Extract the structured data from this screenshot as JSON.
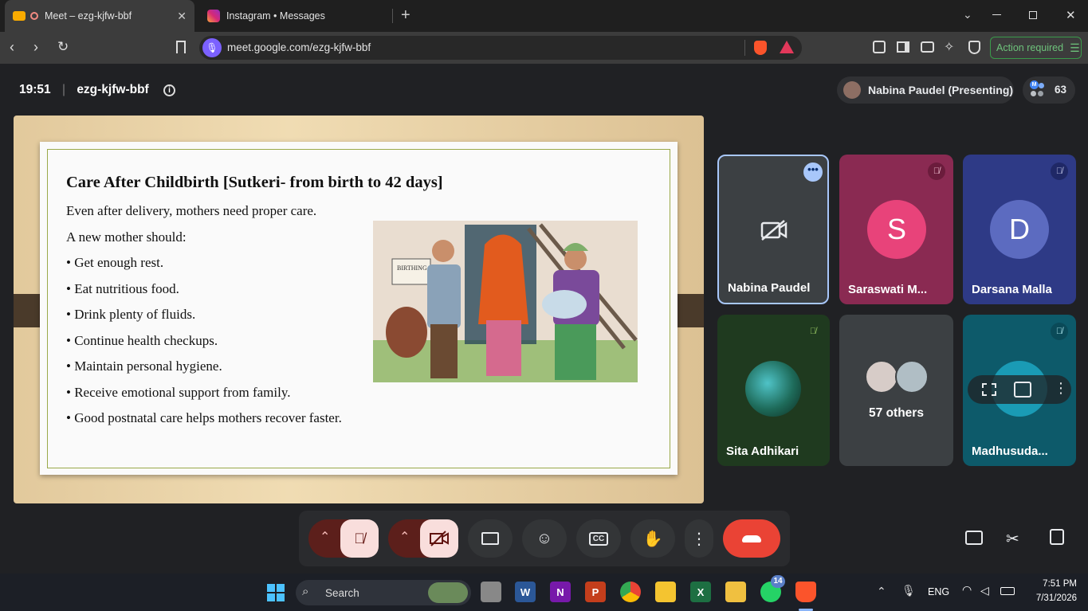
{
  "browser": {
    "tabs": [
      {
        "title": "Meet – ezg-kjfw-bbf",
        "active": true
      },
      {
        "title": "Instagram • Messages",
        "active": false
      }
    ],
    "url": "meet.google.com/ezg-kjfw-bbf",
    "action_required": "Action required"
  },
  "meet": {
    "time": "19:51",
    "meeting_code": "ezg-kjfw-bbf",
    "presenter_chip": "Nabina Paudel (Presenting)",
    "participant_count": "63",
    "count_avatar_letter": "M",
    "slide": {
      "title": "Care After Childbirth [Sutkeri- from birth to 42 days]",
      "lines": [
        "Even after delivery, mothers need proper care.",
        "A new mother should:",
        "• Get enough rest.",
        "• Eat nutritious food.",
        "•  Drink plenty of fluids.",
        "• Continue health checkups.",
        "• Maintain personal hygiene.",
        "• Receive emotional support from family.",
        "• Good postnatal care helps mothers recover faster."
      ],
      "image_sign": "BIRTHING CEN"
    },
    "tiles": [
      {
        "name": "Nabina Paudel",
        "type": "camera-off"
      },
      {
        "name": "Saraswati M...",
        "initial": "S",
        "avatar_color": "#e8437a",
        "bg": "#8a2a52"
      },
      {
        "name": "Darsana Malla",
        "initial": "D",
        "avatar_color": "#5c6bc0",
        "bg": "#2e3a86"
      },
      {
        "name": "Sita Adhikari",
        "type": "globe"
      },
      {
        "name": "57 others",
        "type": "others"
      },
      {
        "name": "Madhusuda...",
        "type": "teal"
      }
    ]
  },
  "taskbar": {
    "search": "Search",
    "whatsapp_badge": "14",
    "lang": "ENG",
    "clock_time": "7:51 PM",
    "clock_date": "7/31/2026"
  },
  "colors": {
    "accent_green": "#6ec27b",
    "end_call": "#ea4335",
    "mute_active": "#f9dedc",
    "tile_border_active": "#a8c7fa"
  }
}
